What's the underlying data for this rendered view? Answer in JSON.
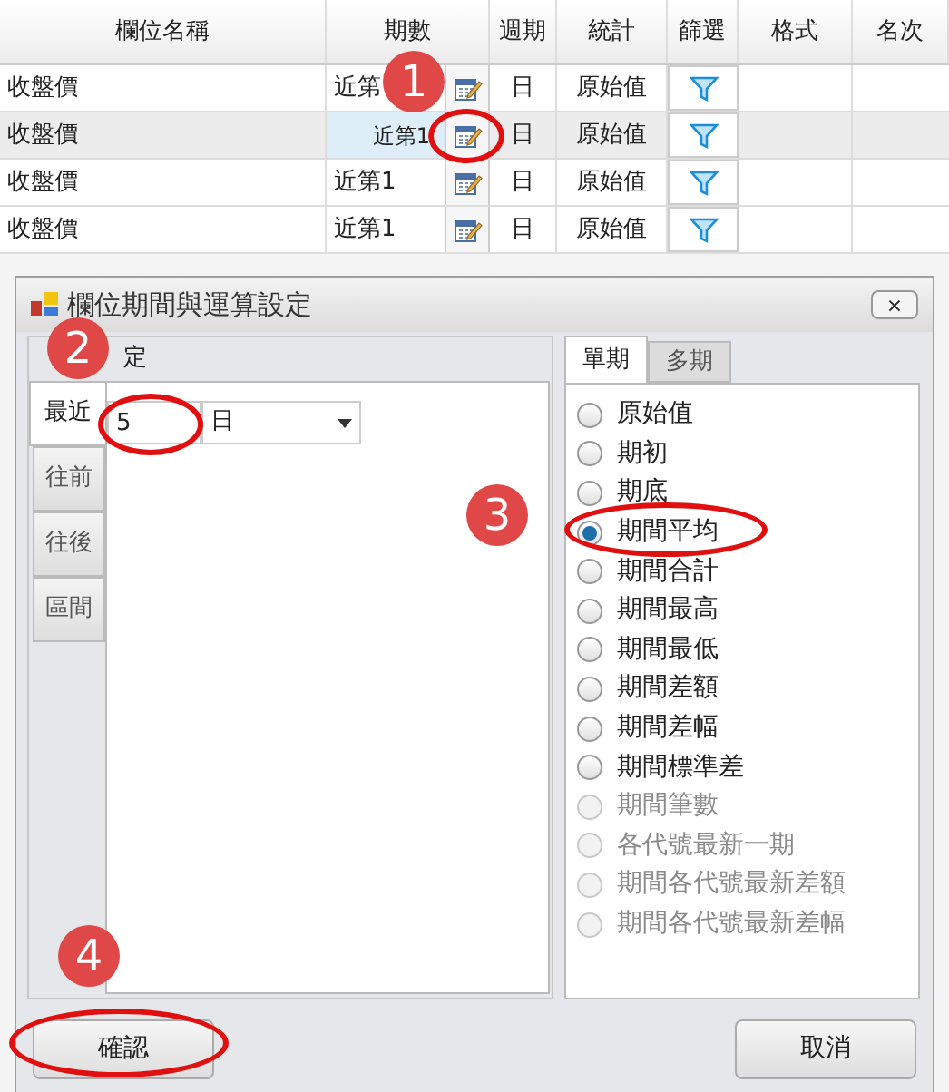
{
  "table": {
    "columns": [
      "欄位名稱",
      "期數",
      "週期",
      "統計",
      "篩選",
      "格式",
      "名次"
    ],
    "rows": [
      {
        "name": "收盤價",
        "period": "近第",
        "cycle": "日",
        "stat": "原始值",
        "selected": false
      },
      {
        "name": "收盤價",
        "period": "近第1",
        "cycle": "日",
        "stat": "原始值",
        "selected": true
      },
      {
        "name": "收盤價",
        "period": "近第1",
        "cycle": "日",
        "stat": "原始值",
        "selected": false
      },
      {
        "name": "收盤價",
        "period": "近第1",
        "cycle": "日",
        "stat": "原始值",
        "selected": false
      }
    ]
  },
  "dialog": {
    "title": "欄位期間與運算設定",
    "close": "×",
    "group_title": "定",
    "side_tabs": [
      {
        "label": "最近",
        "selected": true
      },
      {
        "label": "往前",
        "selected": false
      },
      {
        "label": "往後",
        "selected": false
      },
      {
        "label": "區間",
        "selected": false
      }
    ],
    "count": "5",
    "unit": "日",
    "tabs": [
      {
        "label": "單期",
        "selected": true
      },
      {
        "label": "多期",
        "selected": false
      }
    ],
    "options": [
      {
        "label": "原始值",
        "selected": false,
        "disabled": false
      },
      {
        "label": "期初",
        "selected": false,
        "disabled": false
      },
      {
        "label": "期底",
        "selected": false,
        "disabled": false
      },
      {
        "label": "期間平均",
        "selected": true,
        "disabled": false
      },
      {
        "label": "期間合計",
        "selected": false,
        "disabled": false
      },
      {
        "label": "期間最高",
        "selected": false,
        "disabled": false
      },
      {
        "label": "期間最低",
        "selected": false,
        "disabled": false
      },
      {
        "label": "期間差額",
        "selected": false,
        "disabled": false
      },
      {
        "label": "期間差幅",
        "selected": false,
        "disabled": false
      },
      {
        "label": "期間標準差",
        "selected": false,
        "disabled": false
      },
      {
        "label": "期間筆數",
        "selected": false,
        "disabled": true
      },
      {
        "label": "各代號最新一期",
        "selected": false,
        "disabled": true
      },
      {
        "label": "期間各代號最新差額",
        "selected": false,
        "disabled": true
      },
      {
        "label": "期間各代號最新差幅",
        "selected": false,
        "disabled": true
      }
    ],
    "buttons": [
      "確認",
      "取消"
    ]
  },
  "annotations": [
    {
      "label": "1"
    },
    {
      "label": "2"
    },
    {
      "label": "3"
    },
    {
      "label": "4"
    }
  ]
}
